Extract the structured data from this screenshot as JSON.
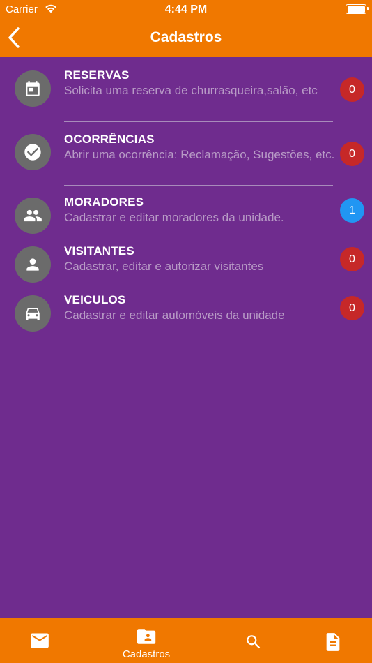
{
  "status_bar": {
    "carrier": "Carrier",
    "time": "4:44 PM",
    "wifi_icon": "wifi-icon",
    "battery_icon": "battery-icon",
    "battery_level": 1.0
  },
  "nav": {
    "title": "Cadastros",
    "back_icon": "chevron-left-icon"
  },
  "colors": {
    "header": "#f07800",
    "background": "#6f2c8e",
    "icon_circle": "#6b6b6b",
    "badge_zero": "#c62828",
    "badge_nonzero": "#2196f3"
  },
  "items": [
    {
      "title": "RESERVAS",
      "description": "Solicita uma reserva de churrasqueira,salão, etc",
      "count": "0",
      "icon": "calendar-icon"
    },
    {
      "title": "OCORRÊNCIAS",
      "description": "Abrir uma ocorrência: Reclamação, Sugestões, etc.",
      "count": "0",
      "icon": "check-circle-icon"
    },
    {
      "title": "MORADORES",
      "description": "Cadastrar e editar moradores da unidade.",
      "count": "1",
      "icon": "people-icon"
    },
    {
      "title": "VISITANTES",
      "description": "Cadastrar, editar e autorizar visitantes",
      "count": "0",
      "icon": "person-icon"
    },
    {
      "title": "VEICULOS",
      "description": "Cadastrar e editar automóveis da unidade",
      "count": "0",
      "icon": "car-icon"
    }
  ],
  "tab_bar": {
    "tabs": [
      {
        "icon": "mail-icon",
        "label": ""
      },
      {
        "icon": "folder-person-icon",
        "label": "Cadastros",
        "selected": true
      },
      {
        "icon": "search-icon",
        "label": ""
      },
      {
        "icon": "document-icon",
        "label": ""
      }
    ]
  }
}
